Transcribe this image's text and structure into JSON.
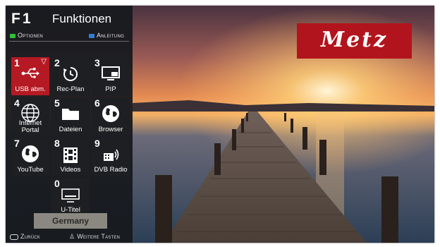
{
  "panel": {
    "function_key": "F1",
    "title": "Funktionen",
    "options_label": "Optionen",
    "guide_label": "Anleitung",
    "options_color": "#2fbf3a",
    "guide_color": "#2f7fd8",
    "back_label": "Zurück",
    "more_keys_label": "Weitere Tasten"
  },
  "tiles": [
    {
      "num": "1",
      "label": "USB abm.",
      "icon": "usb-icon",
      "active": true,
      "indicator": "▽"
    },
    {
      "num": "2",
      "label": "Rec-Plan",
      "icon": "timer-icon"
    },
    {
      "num": "3",
      "label": "PIP",
      "icon": "pip-icon"
    },
    {
      "num": "4",
      "label": "Internet Portal",
      "icon": "globe-icon"
    },
    {
      "num": "5",
      "label": "Dateien",
      "icon": "folder-icon"
    },
    {
      "num": "6",
      "label": "Browser",
      "icon": "browser-globe-icon"
    },
    {
      "num": "7",
      "label": "YouTube",
      "icon": "youtube-globe-icon"
    },
    {
      "num": "8",
      "label": "Videos",
      "icon": "film-icon"
    },
    {
      "num": "9",
      "label": "DVB Radio",
      "icon": "radio-icon"
    },
    {
      "num": "0",
      "label": "U-Titel",
      "icon": "subtitle-icon"
    }
  ],
  "country": "Germany",
  "brand": {
    "name": "Metz",
    "color": "#b2141d"
  }
}
